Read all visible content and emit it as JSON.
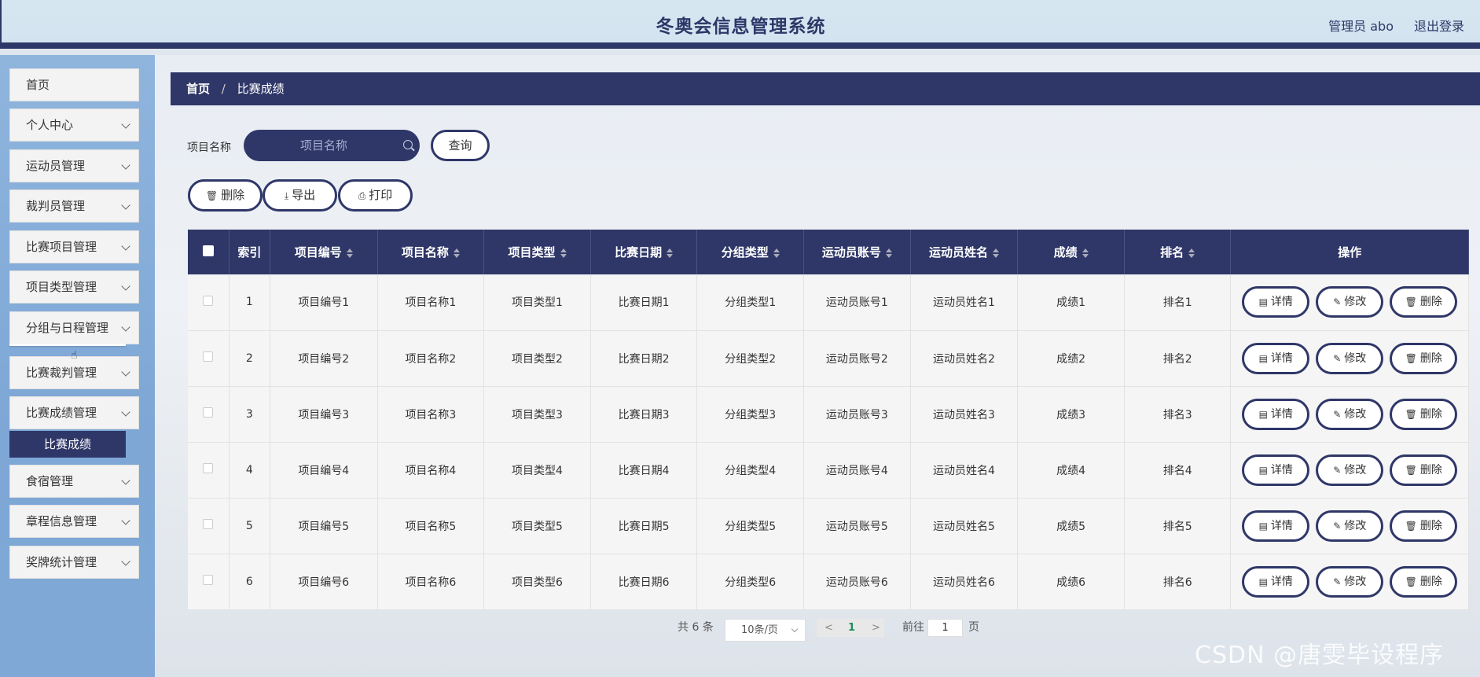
{
  "header": {
    "title": "冬奥会信息管理系统",
    "user": "管理员 abo",
    "logout": "退出登录"
  },
  "sidebar": {
    "items": [
      {
        "label": "首页"
      },
      {
        "label": "个人中心"
      },
      {
        "label": "运动员管理"
      },
      {
        "label": "裁判员管理"
      },
      {
        "label": "比赛项目管理"
      },
      {
        "label": "项目类型管理"
      },
      {
        "label": "分组与日程管理"
      },
      {
        "label": "比赛裁判管理"
      },
      {
        "label": "比赛成绩管理"
      },
      {
        "label": "食宿管理"
      },
      {
        "label": "章程信息管理"
      },
      {
        "label": "奖牌统计管理"
      }
    ],
    "submenu": {
      "label": "比赛成绩"
    }
  },
  "breadcrumb": {
    "home": "首页",
    "sep": "/",
    "current": "比赛成绩"
  },
  "search": {
    "label": "项目名称",
    "placeholder": "项目名称",
    "button": "查询"
  },
  "toolbar": {
    "delete": "删除",
    "export": "导出",
    "print": "打印"
  },
  "table": {
    "headers": [
      "索引",
      "项目编号",
      "项目名称",
      "项目类型",
      "比赛日期",
      "分组类型",
      "运动员账号",
      "运动员姓名",
      "成绩",
      "排名",
      "操作"
    ],
    "rows": [
      [
        "1",
        "项目编号1",
        "项目名称1",
        "项目类型1",
        "比赛日期1",
        "分组类型1",
        "运动员账号1",
        "运动员姓名1",
        "成绩1",
        "排名1"
      ],
      [
        "2",
        "项目编号2",
        "项目名称2",
        "项目类型2",
        "比赛日期2",
        "分组类型2",
        "运动员账号2",
        "运动员姓名2",
        "成绩2",
        "排名2"
      ],
      [
        "3",
        "项目编号3",
        "项目名称3",
        "项目类型3",
        "比赛日期3",
        "分组类型3",
        "运动员账号3",
        "运动员姓名3",
        "成绩3",
        "排名3"
      ],
      [
        "4",
        "项目编号4",
        "项目名称4",
        "项目类型4",
        "比赛日期4",
        "分组类型4",
        "运动员账号4",
        "运动员姓名4",
        "成绩4",
        "排名4"
      ],
      [
        "5",
        "项目编号5",
        "项目名称5",
        "项目类型5",
        "比赛日期5",
        "分组类型5",
        "运动员账号5",
        "运动员姓名5",
        "成绩5",
        "排名5"
      ],
      [
        "6",
        "项目编号6",
        "项目名称6",
        "项目类型6",
        "比赛日期6",
        "分组类型6",
        "运动员账号6",
        "运动员姓名6",
        "成绩6",
        "排名6"
      ]
    ],
    "actions": {
      "detail": "详情",
      "edit": "修改",
      "delete": "删除"
    }
  },
  "pagination": {
    "total": "共 6 条",
    "page_size": "10条/页",
    "prev": "<",
    "current": "1",
    "next": ">",
    "goto_label": "前往",
    "goto_value": "1",
    "page_unit": "页"
  },
  "watermark": "CSDN @唐雯毕设程序",
  "colors": {
    "primary": "#2f3768",
    "sidebar": "#8fb5dd",
    "accent_page": "#1a8f5a"
  }
}
